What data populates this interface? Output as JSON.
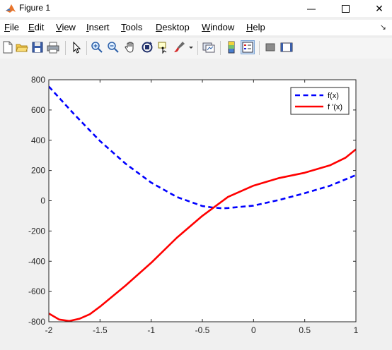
{
  "window": {
    "title": "Figure 1",
    "minimize_glyph": "—",
    "maximize_glyph": "☐",
    "close_glyph": "✕",
    "dock_glyph": "↘"
  },
  "menu": [
    {
      "label": "File",
      "mnemonic": "F",
      "rest": "ile"
    },
    {
      "label": "Edit",
      "mnemonic": "E",
      "rest": "dit"
    },
    {
      "label": "View",
      "mnemonic": "V",
      "rest": "iew"
    },
    {
      "label": "Insert",
      "mnemonic": "I",
      "rest": "nsert"
    },
    {
      "label": "Tools",
      "mnemonic": "T",
      "rest": "ools"
    },
    {
      "label": "Desktop",
      "mnemonic": "D",
      "rest": "esktop"
    },
    {
      "label": "Window",
      "mnemonic": "W",
      "rest": "indow"
    },
    {
      "label": "Help",
      "mnemonic": "H",
      "rest": "elp"
    }
  ],
  "toolbar_icons": [
    "new-figure-icon",
    "open-file-icon",
    "save-icon",
    "print-icon",
    "edit-plot-arrow-icon",
    "zoom-in-icon",
    "zoom-out-icon",
    "pan-hand-icon",
    "rotate-3d-icon",
    "data-cursor-icon",
    "brush-icon",
    "brush-dropdown-icon",
    "link-plot-icon",
    "colorbar-icon",
    "legend-icon",
    "hide-plot-tools-icon",
    "show-plot-tools-icon"
  ],
  "chart_data": {
    "type": "line",
    "xlim": [
      -2,
      1
    ],
    "ylim": [
      -800,
      800
    ],
    "xticks": [
      "-2",
      "-1.5",
      "-1",
      "-0.5",
      "0",
      "0.5",
      "1"
    ],
    "yticks": [
      "800",
      "600",
      "400",
      "200",
      "0",
      "-200",
      "-400",
      "-600",
      "-800"
    ],
    "grid": false,
    "legend_position": "top-right",
    "series": [
      {
        "name": "f(x)",
        "color": "#0000ff",
        "style": "dashed",
        "x": [
          -2,
          -1.75,
          -1.5,
          -1.25,
          -1,
          -0.75,
          -0.5,
          -0.4,
          -0.3,
          -0.25,
          0,
          0.25,
          0.5,
          0.75,
          1
        ],
        "y": [
          755,
          570,
          395,
          245,
          120,
          25,
          -35,
          -45,
          -50,
          -48,
          -32,
          5,
          50,
          100,
          170
        ]
      },
      {
        "name": "f '(x)",
        "color": "#ff0000",
        "style": "solid",
        "x": [
          -2,
          -1.9,
          -1.8,
          -1.7,
          -1.6,
          -1.5,
          -1.25,
          -1,
          -0.75,
          -0.5,
          -0.25,
          0,
          0.25,
          0.5,
          0.75,
          0.9,
          1
        ],
        "y": [
          -745,
          -785,
          -795,
          -780,
          -750,
          -700,
          -560,
          -410,
          -245,
          -100,
          25,
          100,
          150,
          185,
          235,
          285,
          340
        ]
      }
    ]
  }
}
